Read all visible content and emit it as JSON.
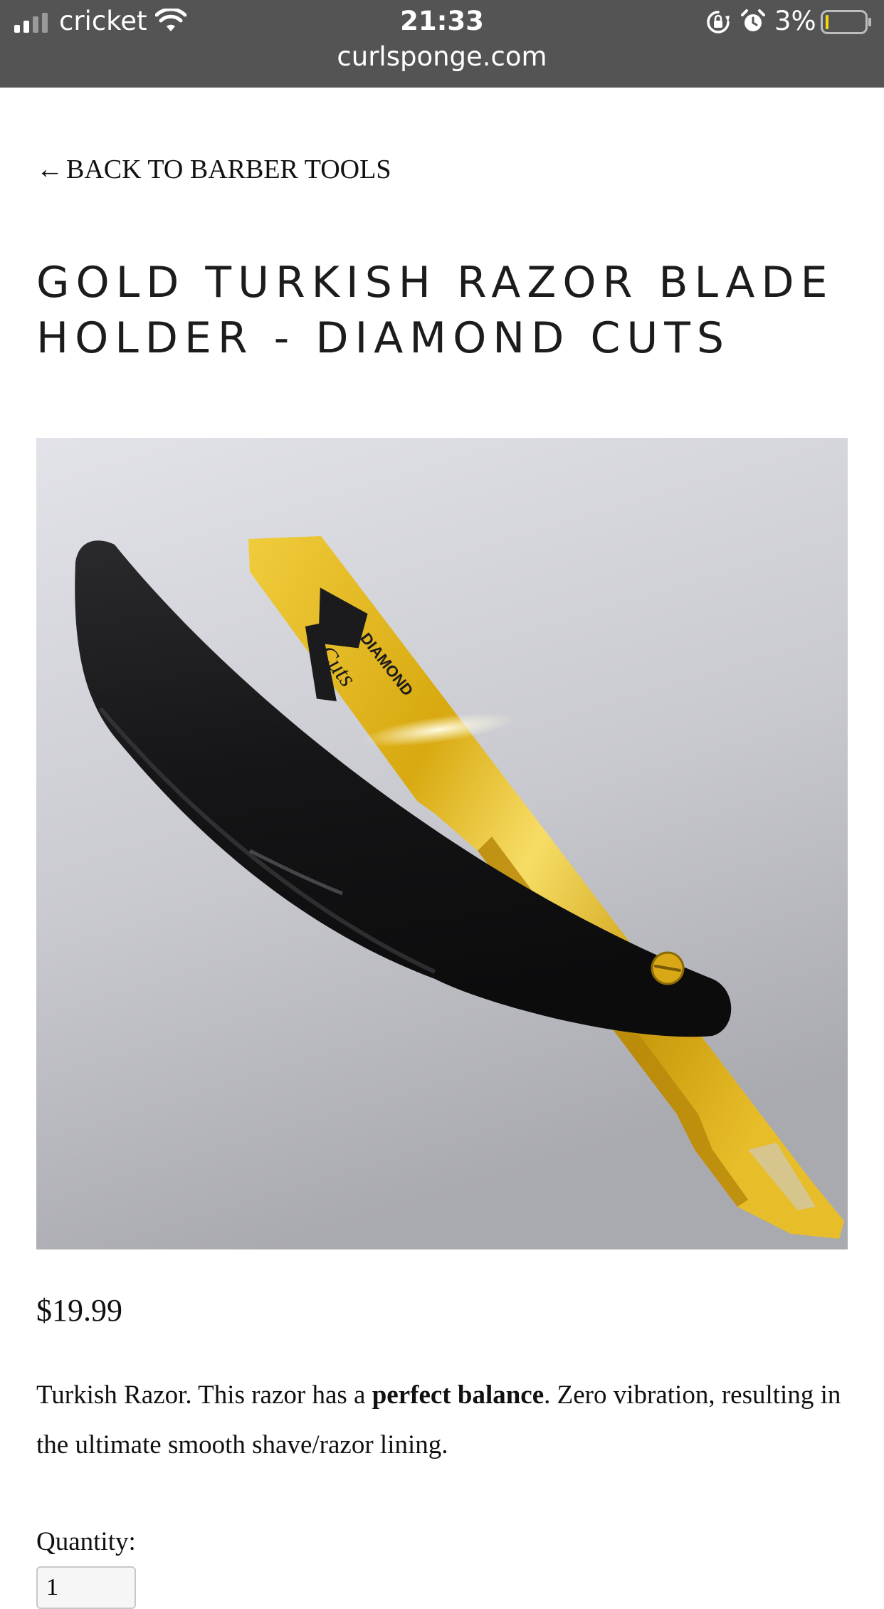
{
  "status_bar": {
    "carrier": "cricket",
    "time": "21:33",
    "url": "curlsponge.com",
    "battery_percent": "3%",
    "icons": [
      "signal-icon",
      "wifi-icon",
      "orientation-lock-icon",
      "alarm-icon",
      "battery-icon"
    ]
  },
  "nav": {
    "back_arrow": "←",
    "back_label": "BACK TO BARBER TOOLS"
  },
  "product": {
    "title": "GOLD TURKISH RAZOR BLADE HOLDER - DIAMOND CUTS",
    "image_logo_text": "DIAMOND Cuts",
    "price": "$19.99",
    "description": {
      "part1": "Turkish Razor. This razor has a ",
      "bold": "perfect balance",
      "part2": ". Zero vibration, resulting in the ultimate smooth shave/razor lining."
    },
    "quantity_label": "Quantity:",
    "quantity_value": "1"
  },
  "colors": {
    "status_bar_bg": "#545454",
    "gold": "#e2b51e",
    "handle": "#1b1b1d",
    "battery_low": "#f5d60f"
  }
}
